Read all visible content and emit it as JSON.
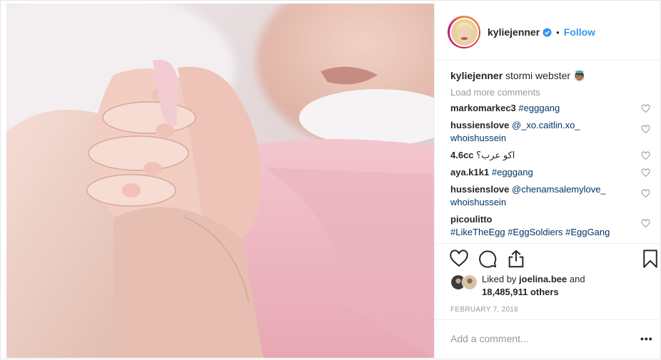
{
  "post": {
    "photo_alt": "Photo by kyliejenner",
    "header": {
      "username": "kyliejenner",
      "separator": "•",
      "follow_label": "Follow"
    },
    "caption": {
      "username": "kyliejenner",
      "text": "stormi webster 👼🏽"
    },
    "load_more_label": "Load more comments",
    "comments": [
      {
        "username": "markomarkec3",
        "text": "#egggang"
      },
      {
        "username": "hussienslove",
        "text": "@_xo.caitlin.xo_ whoishussein"
      },
      {
        "username": "4.6cc",
        "text": "اكو عرب؟"
      },
      {
        "username": "aya.k1k1",
        "text": "#egggang"
      },
      {
        "username": "hussienslove",
        "text": "@chenamsalemylove_ whoishussein"
      },
      {
        "username": "picoulitto",
        "text": "#LikeTheEgg #EggSoldiers #EggGang"
      }
    ],
    "likes": {
      "prefix": "Liked by",
      "user": "joelina.bee",
      "and": "and",
      "count": "18,485,911 others"
    },
    "date": "FEBRUARY 7, 2018",
    "add_comment_placeholder": "Add a comment...",
    "more_label": "•••",
    "colors": {
      "link": "#3897f0",
      "tag": "#003569",
      "muted": "#999999",
      "verified": "#3897f0"
    },
    "icons": [
      "heart-icon",
      "comment-icon",
      "share-icon",
      "bookmark-icon",
      "verified-icon",
      "avatar"
    ]
  }
}
